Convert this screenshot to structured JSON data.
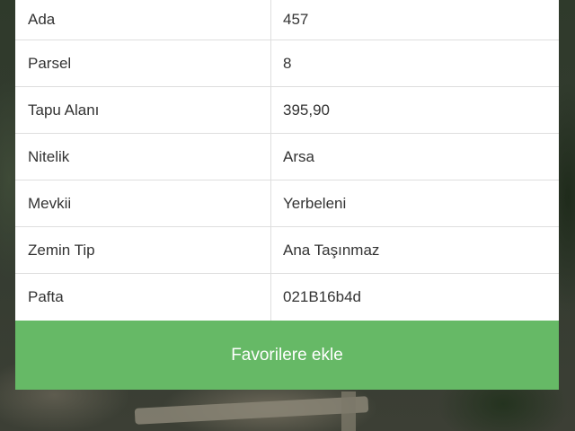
{
  "details": {
    "rows": [
      {
        "key": "Ada",
        "value": "457"
      },
      {
        "key": "Parsel",
        "value": "8"
      },
      {
        "key": "Tapu Alanı",
        "value": "395,90"
      },
      {
        "key": "Nitelik",
        "value": "Arsa"
      },
      {
        "key": "Mevkii",
        "value": "Yerbeleni"
      },
      {
        "key": "Zemin Tip",
        "value": "Ana Taşınmaz"
      },
      {
        "key": "Pafta",
        "value": "021B16b4d"
      }
    ]
  },
  "actions": {
    "favorite_label": "Favorilere ekle"
  },
  "colors": {
    "accent_green": "#66b966",
    "table_bg": "#ffffff",
    "text": "#333333",
    "divider": "#dedede"
  }
}
